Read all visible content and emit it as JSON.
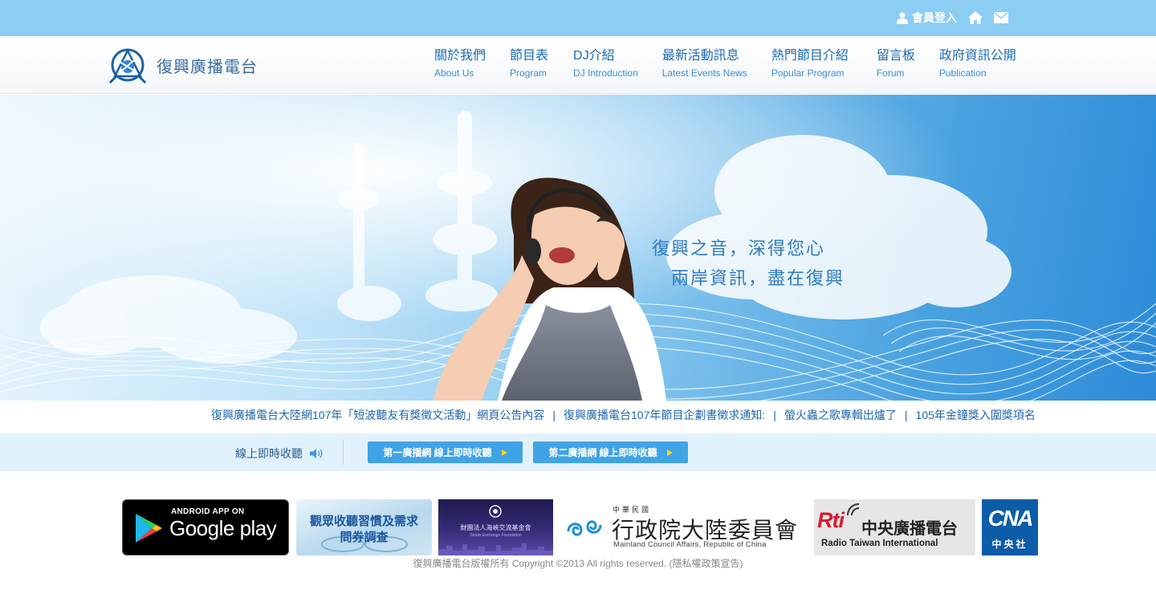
{
  "topbar": {
    "login_label": "會員登入",
    "icons": [
      "user-icon",
      "home-icon",
      "mail-icon"
    ]
  },
  "header": {
    "site_name": "復興廣播電台",
    "nav": [
      {
        "zh": "關於我們",
        "en": "About Us"
      },
      {
        "zh": "節目表",
        "en": "Program"
      },
      {
        "zh": "DJ介紹",
        "en": "DJ Introduction"
      },
      {
        "zh": "最新活動訊息",
        "en": "Latest Events News"
      },
      {
        "zh": "熱門節目介紹",
        "en": "Popular Program"
      },
      {
        "zh": "留言板",
        "en": "Forum"
      },
      {
        "zh": "政府資訊公開",
        "en": "Publication"
      }
    ]
  },
  "hero": {
    "slogan_line1": "復興之音，深得您心",
    "slogan_line2": "兩岸資訊，盡在復興"
  },
  "news": {
    "items": [
      "復興廣播電台大陸網107年「短波聽友有獎徵文活動」網頁公告內容",
      "復興廣播電台107年節目企劃書徵求通知:",
      "螢火蟲之歌專輯出爐了",
      "105年金鐘獎入圍獎項名單"
    ],
    "separator": "|"
  },
  "listen": {
    "label": "線上即時收聽",
    "button1": "第一廣播網 線上即時收聽",
    "button2": "第二廣播網 線上即時收聽"
  },
  "partners": {
    "google_play_small": "ANDROID APP ON",
    "google_play_big": "Google play",
    "survey_line1": "觀眾收聽習慣及需求",
    "survey_line2": "問券調查",
    "strait_name": "財團法人海峽交流基金會",
    "strait_en": "Straits Exchange Foundation",
    "mac_top": "中華民國",
    "mac_name": "行政院大陸委員會",
    "mac_en": "Mainland Council Affairs, Republic of China",
    "rti_logo": "Rti",
    "rti_zh": "中央廣播電台",
    "rti_en": "Radio Taiwan International",
    "cna_logo": "CNA",
    "cna_zh": "中央社"
  },
  "footer": {
    "copyright": "復興廣播電台版權所有 Copyright ©2013 All rights reserved. (隱私權政策宣告)"
  },
  "colors": {
    "topbar": "#8ccdf3",
    "nav_text": "#1d6bb2",
    "listen_button": "#40a3e5",
    "listen_bar": "#e1f1fb"
  }
}
